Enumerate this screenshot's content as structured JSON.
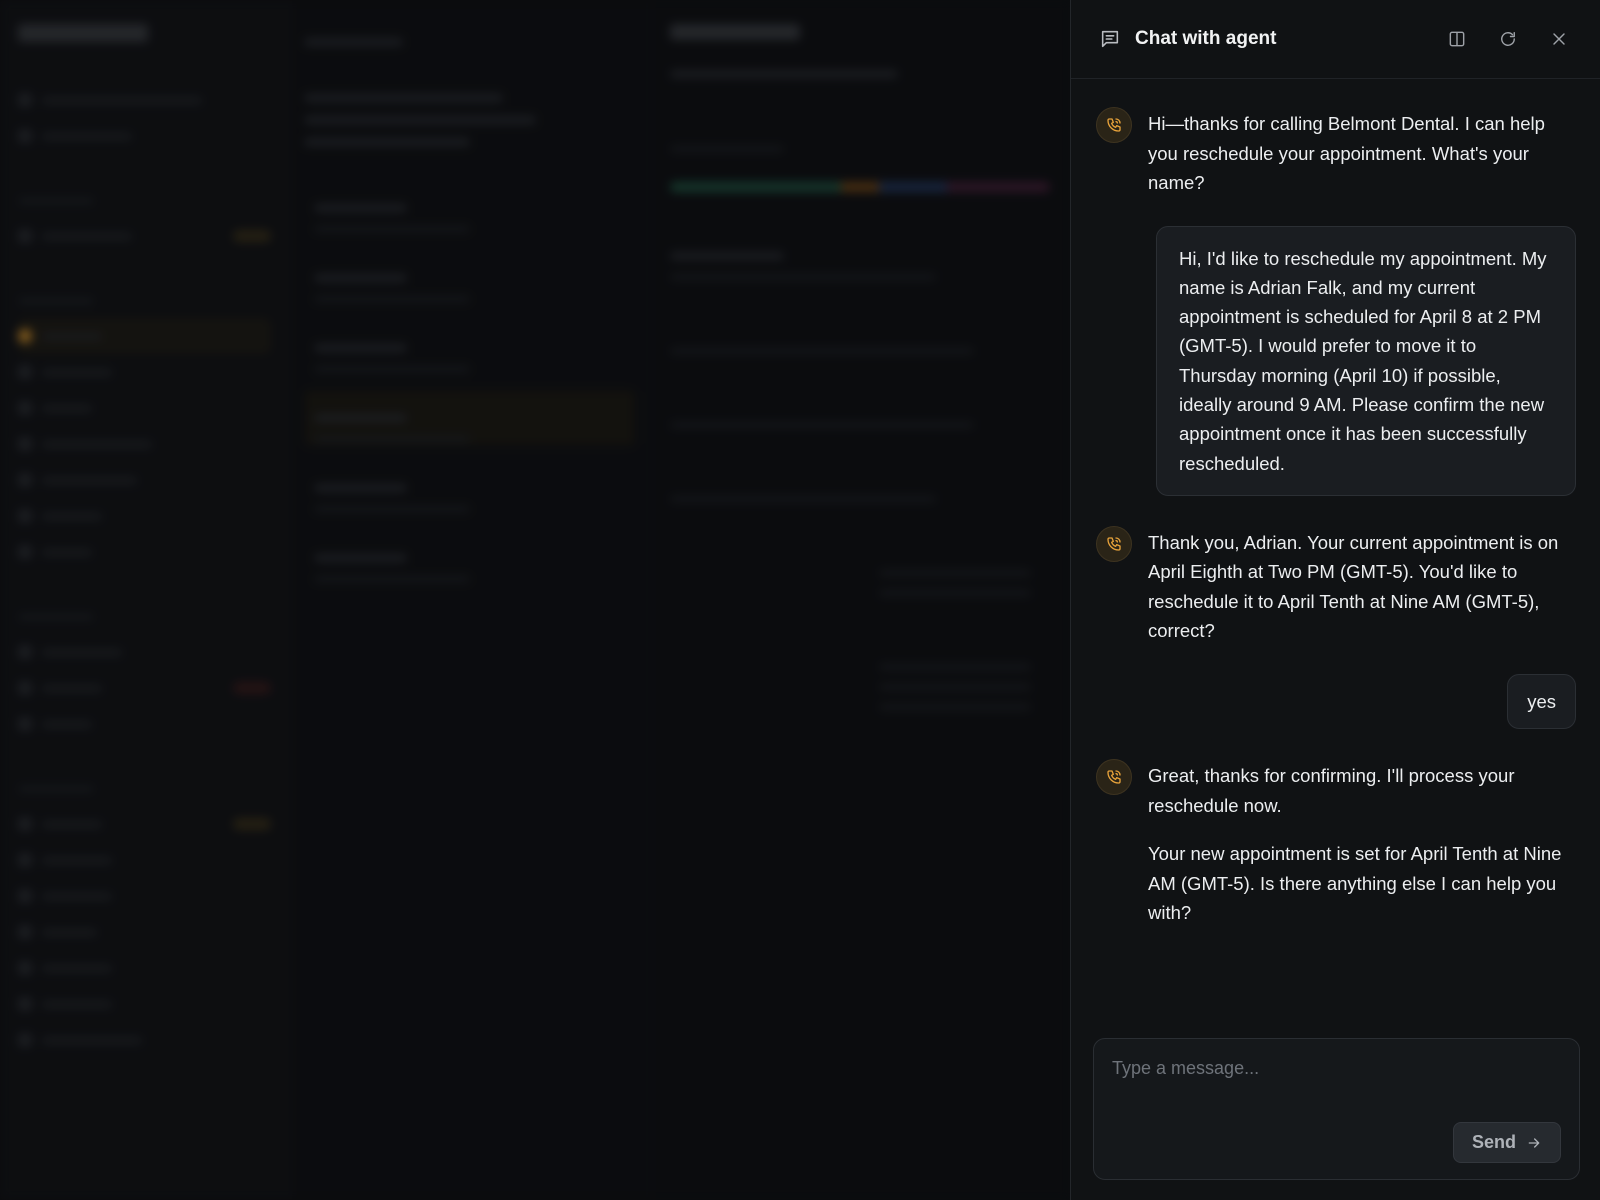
{
  "chat": {
    "title": "Chat with agent",
    "header_icons": [
      "message-square-icon",
      "split-panel-icon",
      "refresh-icon",
      "close-icon"
    ],
    "messages": [
      {
        "role": "agent",
        "paragraphs": [
          "Hi—thanks for calling Belmont Dental. I can help you reschedule your appointment. What's your name?"
        ]
      },
      {
        "role": "user",
        "text": "Hi, I'd like to reschedule my appointment. My name is Adrian Falk, and my current appointment is scheduled for April 8 at 2 PM (GMT-5). I would prefer to move it to Thursday morning (April 10) if possible, ideally around 9 AM. Please confirm the new appointment once it has been successfully rescheduled."
      },
      {
        "role": "agent",
        "paragraphs": [
          "Thank you, Adrian. Your current appointment is on April Eighth at Two PM (GMT-5). You'd like to reschedule it to April Tenth at Nine AM (GMT-5), correct?"
        ]
      },
      {
        "role": "user",
        "text": "yes"
      },
      {
        "role": "agent",
        "paragraphs": [
          "Great, thanks for confirming. I'll process your reschedule now.",
          "Your new appointment is set for April Tenth at Nine AM (GMT-5). Is there anything else I can help you with?"
        ]
      }
    ],
    "composer": {
      "placeholder": "Type a message...",
      "send_label": "Send"
    }
  },
  "colors": {
    "accent": "#e8a33b",
    "panel_bg": "#101214",
    "bubble_bg": "#1a1d21"
  }
}
